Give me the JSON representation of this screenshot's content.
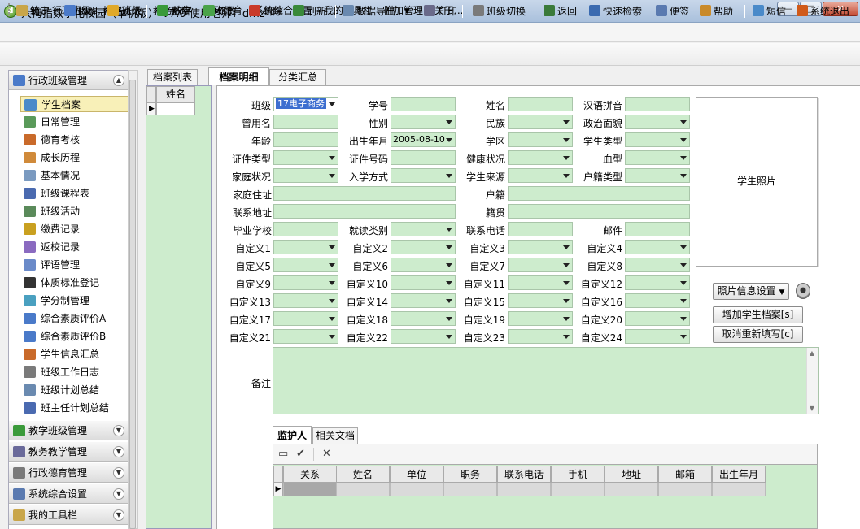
{
  "window": {
    "title": "大拇指数字化校园（单机版） V7.0 使用老师：dmz",
    "app_icon": "app-logo-icon",
    "min": "—",
    "max": "□",
    "close": "✕"
  },
  "menu": [
    "系统",
    "行政班级",
    "教学班级",
    "教务教学",
    "行政德育",
    "系统综合设置",
    "我的工具栏",
    "附加管理",
    "关于..."
  ],
  "toolbar": [
    {
      "label": "锁定",
      "icon": "lock-icon",
      "color": "#c9a64a"
    },
    {
      "label": "提醒",
      "icon": "reminder-icon",
      "color": "#4a7ac9"
    },
    {
      "label": "通讯",
      "icon": "chat-icon",
      "color": "#e0a92a"
    },
    {
      "label": "新增",
      "icon": "add-icon",
      "color": "#3a9a3a"
    },
    {
      "label": "修改",
      "icon": "check-icon",
      "color": "#4aa34a"
    },
    {
      "label": "删除",
      "icon": "delete-icon",
      "color": "#c93a2a"
    },
    {
      "label": "刷新",
      "icon": "refresh-icon",
      "color": "#3a8a3a"
    },
    {
      "label": "数据导出",
      "icon": "export-icon",
      "color": "#6a8ab0"
    },
    {
      "label": "打印",
      "icon": "print-icon",
      "color": "#6a6a8a"
    },
    {
      "label": "班级切换",
      "icon": "switch-icon",
      "color": "#7a7a7a"
    },
    {
      "label": "返回",
      "icon": "back-icon",
      "color": "#3a7a3a"
    },
    {
      "label": "快速检索",
      "icon": "search-icon",
      "color": "#3a6ab0"
    },
    {
      "label": "便签",
      "icon": "note-icon",
      "color": "#5a7ab0"
    },
    {
      "label": "帮助",
      "icon": "help-icon",
      "color": "#c98a2a"
    },
    {
      "label": "短信",
      "icon": "sms-icon",
      "color": "#4a8ac9"
    },
    {
      "label": "系统退出",
      "icon": "exit-icon",
      "color": "#d05a1a"
    }
  ],
  "sidebar": {
    "groups": [
      {
        "label": "行政班级管理",
        "icon": "admin-class-icon",
        "color": "#4a7ac9",
        "expanded": true
      },
      {
        "label": "教学班级管理",
        "icon": "teaching-class-icon",
        "color": "#3a9a3a",
        "expanded": false
      },
      {
        "label": "教务教学管理",
        "icon": "abc-icon",
        "color": "#6a6a9a",
        "expanded": false
      },
      {
        "label": "行政德育管理",
        "icon": "moral-icon",
        "color": "#7a7a7a",
        "expanded": false
      },
      {
        "label": "系统综合设置",
        "icon": "settings-icon",
        "color": "#5a7ab0",
        "expanded": false
      },
      {
        "label": "我的工具栏",
        "icon": "toolbox-icon",
        "color": "#c9a64a",
        "expanded": false
      }
    ],
    "items": [
      {
        "label": "学生档案",
        "icon": "student-file-icon",
        "color": "#4a8ac9",
        "active": true
      },
      {
        "label": "日常管理",
        "icon": "clock-icon",
        "color": "#5a9a5a"
      },
      {
        "label": "德育考核",
        "icon": "moral-check-icon",
        "color": "#c96a2a"
      },
      {
        "label": "成长历程",
        "icon": "growth-icon",
        "color": "#d08a3a"
      },
      {
        "label": "基本情况",
        "icon": "info-icon",
        "color": "#7a9ac0"
      },
      {
        "label": "班级课程表",
        "icon": "timetable-icon",
        "color": "#4a6ab0"
      },
      {
        "label": "班级活动",
        "icon": "activity-icon",
        "color": "#5a8a5a"
      },
      {
        "label": "缴费记录",
        "icon": "yen-icon",
        "color": "#c9a020"
      },
      {
        "label": "返校记录",
        "icon": "return-icon",
        "color": "#8a6ac0"
      },
      {
        "label": "评语管理",
        "icon": "comment-icon",
        "color": "#6a8ac9"
      },
      {
        "label": "体质标准登记",
        "icon": "football-icon",
        "color": "#333333"
      },
      {
        "label": "学分制管理",
        "icon": "credit-icon",
        "color": "#4aa0c0"
      },
      {
        "label": "综合素质评价A",
        "icon": "evaluation-a-icon",
        "color": "#4a7ac9"
      },
      {
        "label": "综合素质评价B",
        "icon": "evaluation-b-icon",
        "color": "#4a7ac9"
      },
      {
        "label": "学生信息汇总",
        "icon": "summary-icon",
        "color": "#c96a2a"
      },
      {
        "label": "班级工作日志",
        "icon": "log-icon",
        "color": "#7a7a7a"
      },
      {
        "label": "班级计划总结",
        "icon": "plan-icon",
        "color": "#6a8ab0"
      },
      {
        "label": "班主任计划总结",
        "icon": "teacher-plan-icon",
        "color": "#4a6ab0"
      }
    ]
  },
  "tabs": {
    "list": "档案列表",
    "detail": "档案明细",
    "summary": "分类汇总"
  },
  "list": {
    "header": "姓名",
    "row_indicator": "▶"
  },
  "form": {
    "class_label": "班级",
    "class_value": "17电子商务",
    "student_no": "学号",
    "name": "姓名",
    "pinyin": "汉语拼音",
    "former_name": "曾用名",
    "gender": "性别",
    "ethnicity": "民族",
    "political": "政治面貌",
    "age": "年龄",
    "birth": "出生年月",
    "birth_value": "2005-08-10",
    "district": "学区",
    "student_type": "学生类型",
    "id_type": "证件类型",
    "id_no": "证件号码",
    "health": "健康状况",
    "blood": "血型",
    "family_status": "家庭状况",
    "enroll_method": "入学方式",
    "origin": "学生来源",
    "hukou_type": "户籍类型",
    "home_address": "家庭住址",
    "hukou": "户籍",
    "contact_address": "联系地址",
    "native_place": "籍贯",
    "grad_school": "毕业学校",
    "study_type": "就读类别",
    "phone": "联系电话",
    "email": "邮件",
    "custom": [
      "自定义1",
      "自定义2",
      "自定义3",
      "自定义4",
      "自定义5",
      "自定义6",
      "自定义7",
      "自定义8",
      "自定义9",
      "自定义10",
      "自定义11",
      "自定义12",
      "自定义13",
      "自定义14",
      "自定义15",
      "自定义16",
      "自定义17",
      "自定义18",
      "自定义19",
      "自定义20",
      "自定义21",
      "自定义22",
      "自定义23",
      "自定义24"
    ],
    "remark": "备注"
  },
  "photo": {
    "label": "学生照片",
    "settings_button": "照片信息设置",
    "add_button": "增加学生档案[s]",
    "reset_button": "取消重新填写[c]"
  },
  "guardian": {
    "tabs": [
      "监护人",
      "相关文档"
    ],
    "toolbar": [
      "▭",
      "✔",
      "✕"
    ],
    "columns": [
      "关系",
      "姓名",
      "单位",
      "职务",
      "联系电话",
      "手机",
      "地址",
      "邮箱",
      "出生年月"
    ]
  }
}
